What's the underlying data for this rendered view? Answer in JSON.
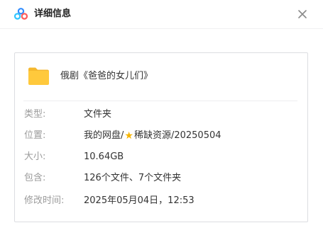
{
  "header": {
    "title": "详细信息",
    "logo_icon": "baidu-netdisk-logo-icon",
    "close_icon": "close-icon"
  },
  "file": {
    "icon": "folder-icon",
    "name": "俄剧《爸爸的女儿们》"
  },
  "properties": {
    "type": {
      "label": "类型:",
      "value": "文件夹"
    },
    "location": {
      "label": "位置:",
      "prefix": "我的网盘/",
      "star_icon": "star-icon",
      "suffix": "稀缺资源/20250504"
    },
    "size": {
      "label": "大小:",
      "value": "10.64GB"
    },
    "contains": {
      "label": "包含:",
      "value": "126个文件、7个文件夹"
    },
    "modified": {
      "label": "修改时间:",
      "value": "2025年05月04日，12:53"
    }
  },
  "colors": {
    "folder": "#ffc93c",
    "folder_tab": "#f5b82e",
    "star": "#f7b500",
    "logo_blue": "#2f8cff",
    "logo_cyan": "#32c5ff",
    "logo_red": "#ff5b5b"
  }
}
